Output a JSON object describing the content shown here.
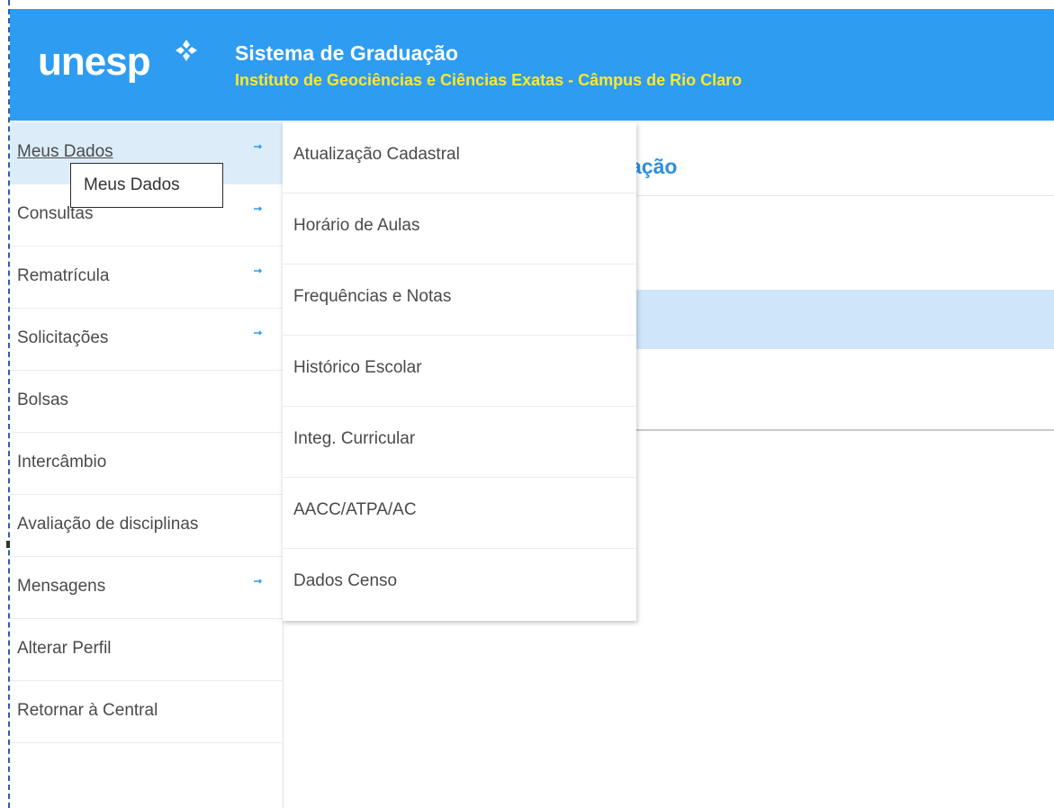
{
  "header": {
    "logo_text": "unesp",
    "logo_icon": "unesp-flower-icon",
    "title": "Sistema de Graduação",
    "subtitle": "Instituto de Geociências e Ciências Exatas - Câmpus de Rio Claro",
    "colors": {
      "background": "#2e9cf0",
      "title": "#ffffff",
      "subtitle": "#ffe82a"
    }
  },
  "sidebar": {
    "items": [
      {
        "label": "Meus Dados",
        "has_submenu": true,
        "active": true
      },
      {
        "label": "Consultas",
        "has_submenu": true
      },
      {
        "label": "Rematrícula",
        "has_submenu": true
      },
      {
        "label": "Solicitações",
        "has_submenu": true
      },
      {
        "label": "Bolsas",
        "has_submenu": false
      },
      {
        "label": "Intercâmbio",
        "has_submenu": false
      },
      {
        "label": "Avaliação de disciplinas",
        "has_submenu": false
      },
      {
        "label": "Mensagens",
        "has_submenu": true
      },
      {
        "label": "Alterar Perfil",
        "has_submenu": false
      },
      {
        "label": "Retornar à Central",
        "has_submenu": false
      }
    ],
    "arrow_icon": "arrow-right-icon",
    "active_color": "#dcedf9"
  },
  "submenu": {
    "items": [
      {
        "label": "Atualização Cadastral"
      },
      {
        "label": "Horário de Aulas"
      },
      {
        "label": "Frequências e Notas"
      },
      {
        "label": "Histórico Escolar"
      },
      {
        "label": "Integ. Curricular"
      },
      {
        "label": "AACC/ATPA/AC"
      },
      {
        "label": "Dados Censo"
      }
    ]
  },
  "tooltip": {
    "text": "Meus Dados"
  },
  "page": {
    "title_partial": "ação",
    "title_color": "#2e8fe0"
  }
}
